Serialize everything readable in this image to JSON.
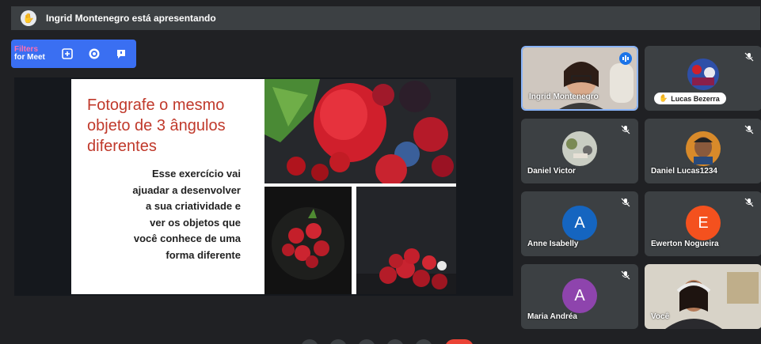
{
  "banner": {
    "presenting_text": "Ingrid Montenegro está apresentando",
    "icon": "presenter-hand-icon"
  },
  "filters_bar": {
    "logo_line1": "Filters",
    "logo_line2": "for Meet",
    "buttons": [
      "add-frame-icon",
      "emoji-icon",
      "chat-icon"
    ]
  },
  "slide": {
    "title": "Fotografe o mesmo objeto de 3 ângulos diferentes",
    "body": "Esse exercício vai ajuadar a desenvolver a sua criatividade e ver os objetos que você conhece de uma forma diferente",
    "accent_color": "#c0392b"
  },
  "participants": [
    {
      "name": "Ingrid Montenegro",
      "kind": "video",
      "speaking": true
    },
    {
      "name": "Lucas Bezerra",
      "kind": "photo",
      "muted": true
    },
    {
      "name": "Daniel Victor",
      "kind": "photo",
      "muted": true
    },
    {
      "name": "Daniel Lucas1234",
      "kind": "photo",
      "muted": true
    },
    {
      "name": "Anne Isabelly",
      "kind": "letter",
      "letter": "A",
      "color": "#1565c0",
      "muted": true
    },
    {
      "name": "Ewerton Nogueira",
      "kind": "letter",
      "letter": "E",
      "color": "#f4511e",
      "muted": true
    },
    {
      "name": "Maria Andréa",
      "kind": "letter",
      "letter": "A",
      "color": "#8e44ad",
      "muted": true
    },
    {
      "name": "Você",
      "kind": "video"
    }
  ],
  "colors": {
    "tile_bg": "#3c4043",
    "stage_bg": "#15181d",
    "toolbar_blue": "#3a6ff2"
  }
}
